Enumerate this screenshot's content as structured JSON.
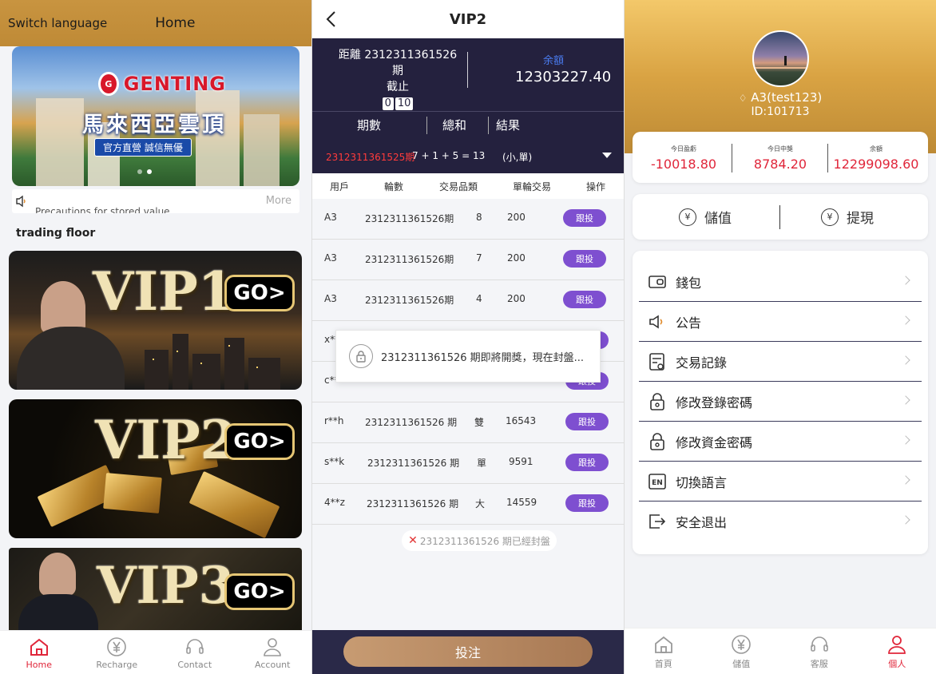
{
  "panel1": {
    "header": {
      "switch_language": "Switch language",
      "home": "Home"
    },
    "banner": {
      "brand": "GENTING",
      "chinese_title": "馬來西亞雲頂",
      "subtitle": "官方直營 誠信無優"
    },
    "notice": {
      "text": "Precautions for stored value",
      "more": "More"
    },
    "section_title": "trading floor",
    "vip_cards": [
      {
        "label": "VIP1",
        "go": "GO>"
      },
      {
        "label": "VIP2",
        "go": "GO>"
      },
      {
        "label": "VIP3",
        "go": "GO>"
      }
    ],
    "tabs": [
      {
        "label": "Home",
        "icon": "home-icon",
        "active": true
      },
      {
        "label": "Recharge",
        "icon": "yen-coin-icon",
        "active": false
      },
      {
        "label": "Contact",
        "icon": "headset-icon",
        "active": false
      },
      {
        "label": "Account",
        "icon": "user-icon",
        "active": false
      }
    ],
    "colors": {
      "header": "#c89440",
      "active_tab": "#e0263a"
    }
  },
  "panel2": {
    "title": "VIP2",
    "countdown": {
      "line1": "距離 2312311361526 期",
      "line2": "截止",
      "minutes": "0",
      "seconds": "10"
    },
    "balance": {
      "label": "余額",
      "value": "12303227.40"
    },
    "columns": {
      "period": "期數",
      "sum": "總和",
      "result": "結果"
    },
    "latest": {
      "period": "2312311361525期",
      "sum": "7 + 1 + 5 = 13",
      "result": "(小,單)"
    },
    "table_headers": {
      "user": "用戶",
      "round": "輪數",
      "item": "交易品類",
      "single": "單輪交易",
      "action": "操作"
    },
    "rows": [
      {
        "user": "A3",
        "round": "2312311361526期",
        "item": "8",
        "amount": "200",
        "action": "跟投"
      },
      {
        "user": "A3",
        "round": "2312311361526期",
        "item": "7",
        "amount": "200",
        "action": "跟投"
      },
      {
        "user": "A3",
        "round": "2312311361526期",
        "item": "4",
        "amount": "200",
        "action": "跟投"
      },
      {
        "user": "x**",
        "round": "",
        "item": "",
        "amount": "",
        "action": "跟投"
      },
      {
        "user": "c**",
        "round": "",
        "item": "",
        "amount": "",
        "action": "跟投"
      },
      {
        "user": "r**h",
        "round": "2312311361526 期",
        "item": "雙",
        "amount": "16543",
        "action": "跟投"
      },
      {
        "user": "s**k",
        "round": "2312311361526 期",
        "item": "單",
        "amount": "9591",
        "action": "跟投"
      },
      {
        "user": "4**z",
        "round": "2312311361526 期",
        "item": "大",
        "amount": "14559",
        "action": "跟投"
      }
    ],
    "toast": "2312311361526 期即將開獎，現在封盤...",
    "closed_notice": "2312311361526 期已經封盤",
    "bet_button": "投注",
    "colors": {
      "dark": "#24213e",
      "follow": "#7e4fd0",
      "period_red": "#ff3b3b"
    }
  },
  "panel3": {
    "username": "A3(test123)",
    "user_id": "ID:101713",
    "stats": [
      {
        "label": "今日盈虧",
        "value": "-10018.80"
      },
      {
        "label": "今日中獎",
        "value": "8784.20"
      },
      {
        "label": "余額",
        "value": "12299098.60"
      }
    ],
    "deposit": "儲值",
    "withdraw": "提現",
    "menu": [
      {
        "label": "錢包",
        "icon": "wallet-icon"
      },
      {
        "label": "公告",
        "icon": "speaker-icon"
      },
      {
        "label": "交易記錄",
        "icon": "records-icon"
      },
      {
        "label": "修改登錄密碼",
        "icon": "lock-icon"
      },
      {
        "label": "修改資金密碼",
        "icon": "lock-icon"
      },
      {
        "label": "切換語言",
        "icon": "en-language-icon"
      },
      {
        "label": "安全退出",
        "icon": "logout-icon"
      }
    ],
    "tabs": [
      {
        "label": "首頁",
        "icon": "home-icon",
        "active": false
      },
      {
        "label": "儲值",
        "icon": "yen-coin-icon",
        "active": false
      },
      {
        "label": "客服",
        "icon": "headset-icon",
        "active": false
      },
      {
        "label": "個人",
        "icon": "user-icon",
        "active": true
      }
    ]
  }
}
